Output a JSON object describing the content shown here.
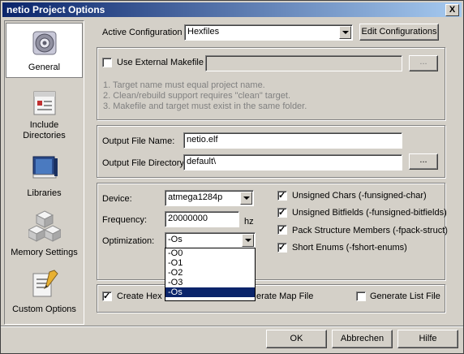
{
  "window": {
    "title": "netio Project Options",
    "close_glyph": "X"
  },
  "sidebar": {
    "items": [
      {
        "label": "General",
        "icon": "gear-icon",
        "selected": true
      },
      {
        "label": "Include Directories",
        "icon": "folder-doc-icon"
      },
      {
        "label": "Libraries",
        "icon": "book-icon"
      },
      {
        "label": "Memory Settings",
        "icon": "blocks-icon"
      },
      {
        "label": "Custom Options",
        "icon": "pencil-doc-icon"
      }
    ]
  },
  "config": {
    "label": "Active Configuration",
    "value": "Hexfiles",
    "edit_button": "Edit Configurations"
  },
  "makefile": {
    "checkbox_label": "Use External Makefile",
    "checked": false,
    "path": "",
    "browse": "...",
    "notes": [
      "1. Target name must equal project name.",
      "2. Clean/rebuild support requires \"clean\" target.",
      "3. Makefile and target must exist in the same folder."
    ]
  },
  "output": {
    "file_label": "Output File Name:",
    "file_value": "netio.elf",
    "dir_label": "Output File Directory:",
    "dir_value": "default\\",
    "browse": "..."
  },
  "device": {
    "device_label": "Device:",
    "device_value": "atmega1284p",
    "freq_label": "Frequency:",
    "freq_value": "20000000",
    "freq_unit": "hz",
    "opt_label": "Optimization:",
    "opt_value": "-Os",
    "opt_options": [
      "-O0",
      "-O1",
      "-O2",
      "-O3",
      "-Os"
    ]
  },
  "flags": [
    {
      "label": "Unsigned Chars (-funsigned-char)",
      "checked": true
    },
    {
      "label": "Unsigned Bitfields (-funsigned-bitfields)",
      "checked": true
    },
    {
      "label": "Pack Structure Members (-fpack-struct)",
      "checked": true
    },
    {
      "label": "Short Enums (-fshort-enums)",
      "checked": true
    }
  ],
  "outputs": {
    "hex_label": "Create Hex File",
    "hex_visible": "Create Hex F",
    "map_label": "Generate Map File",
    "map_visible": "erate Map File",
    "list_label": "Generate List File"
  },
  "buttons": {
    "ok": "OK",
    "cancel": "Abbrechen",
    "help": "Hilfe"
  }
}
